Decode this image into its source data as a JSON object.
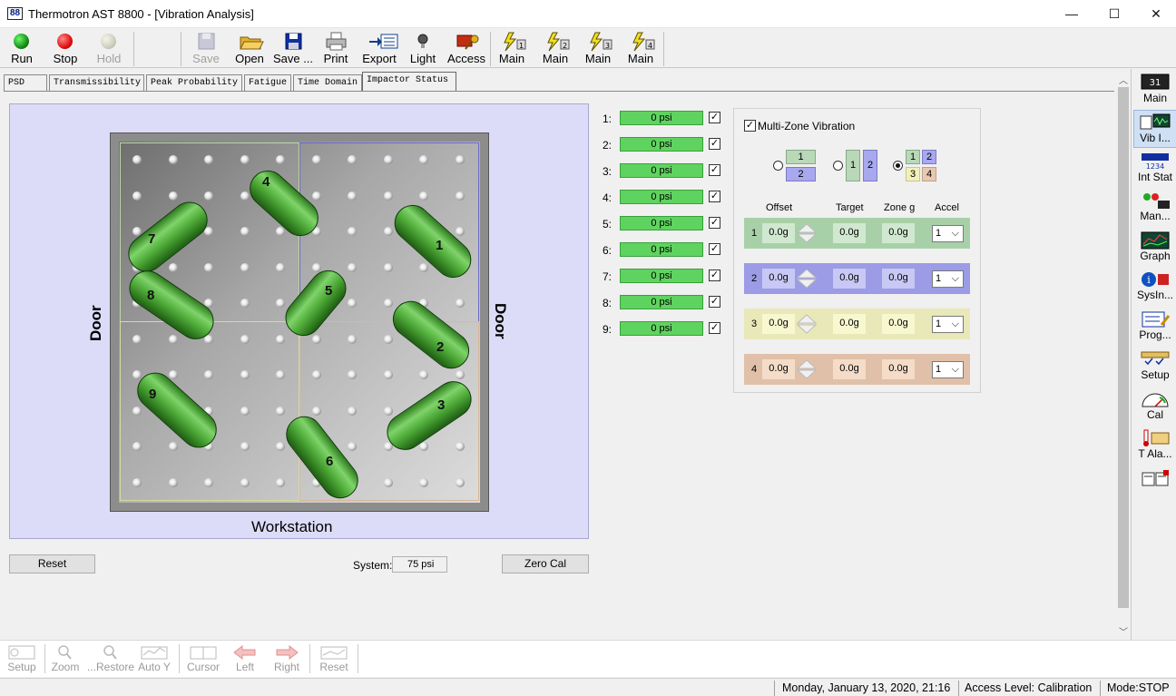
{
  "window": {
    "app_icon": "88",
    "title": "Thermotron AST 8800 - [Vibration Analysis]",
    "minimize_glyph": "—",
    "maximize_glyph": "☐",
    "close_glyph": "✕"
  },
  "toolbar": {
    "run": "Run",
    "stop": "Stop",
    "hold": "Hold",
    "save": "Save",
    "open": "Open",
    "save_as": "Save ...",
    "print": "Print",
    "export": "Export",
    "light": "Light",
    "access": "Access",
    "main1": "Main",
    "main2": "Main",
    "main3": "Main",
    "main4": "Main"
  },
  "tabs": [
    "PSD",
    "Transmissibility",
    "Peak Probability",
    "Fatigue",
    "Time Domain",
    "Impactor Status"
  ],
  "active_tab": "Impactor Status",
  "table": {
    "label_left": "Door",
    "label_right": "Door",
    "label_bottom": "Workstation",
    "impactor_numbers": [
      "1",
      "2",
      "3",
      "4",
      "5",
      "6",
      "7",
      "8",
      "9"
    ]
  },
  "impactors": [
    {
      "label": "1:",
      "value": "0 psi",
      "checked": "✓"
    },
    {
      "label": "2:",
      "value": "0 psi",
      "checked": "✓"
    },
    {
      "label": "3:",
      "value": "0 psi",
      "checked": "✓"
    },
    {
      "label": "4:",
      "value": "0 psi",
      "checked": "✓"
    },
    {
      "label": "5:",
      "value": "0 psi",
      "checked": "✓"
    },
    {
      "label": "6:",
      "value": "0 psi",
      "checked": "✓"
    },
    {
      "label": "7:",
      "value": "0 psi",
      "checked": "✓"
    },
    {
      "label": "8:",
      "value": "0 psi",
      "checked": "✓"
    },
    {
      "label": "9:",
      "value": "0 psi",
      "checked": "✓"
    }
  ],
  "multizone": {
    "label": "Multi-Zone Vibration",
    "checked": "✓",
    "layout_options": {
      "opt1": [
        "1",
        "2"
      ],
      "opt2": [
        "1",
        "2"
      ],
      "opt3": [
        "1",
        "2",
        "3",
        "4"
      ],
      "selected": "opt3"
    },
    "headers": {
      "offset": "Offset",
      "target": "Target",
      "zone_g": "Zone g",
      "accel": "Accel"
    },
    "zones": [
      {
        "num": "1",
        "offset": "0.0g",
        "target": "0.0g",
        "zone_g": "0.0g",
        "accel": "1",
        "color": "#a8d0a8"
      },
      {
        "num": "2",
        "offset": "0.0g",
        "target": "0.0g",
        "zone_g": "0.0g",
        "accel": "1",
        "color": "#9b9be6"
      },
      {
        "num": "3",
        "offset": "0.0g",
        "target": "0.0g",
        "zone_g": "0.0g",
        "accel": "1",
        "color": "#e8e8b8"
      },
      {
        "num": "4",
        "offset": "0.0g",
        "target": "0.0g",
        "zone_g": "0.0g",
        "accel": "1",
        "color": "#e0c0a8"
      }
    ]
  },
  "controls": {
    "reset": "Reset",
    "system_label": "System:",
    "system_value": "75 psi",
    "zero_cal": "Zero Cal"
  },
  "rightbar": [
    "Main",
    "Vib I...",
    "Int Stat",
    "Man...",
    "Graph",
    "SysIn...",
    "Prog...",
    "Setup",
    "Cal",
    "T Ala...",
    ""
  ],
  "rightbar_main_icon_text": "31",
  "bottombar": [
    "Setup",
    "Zoom",
    "...Restore",
    "Auto Y",
    "Cursor",
    "Left",
    "Right",
    "Reset"
  ],
  "status": {
    "datetime": "Monday, January 13, 2020, 21:16",
    "access": "Access Level: Calibration",
    "mode": "Mode:STOP"
  }
}
